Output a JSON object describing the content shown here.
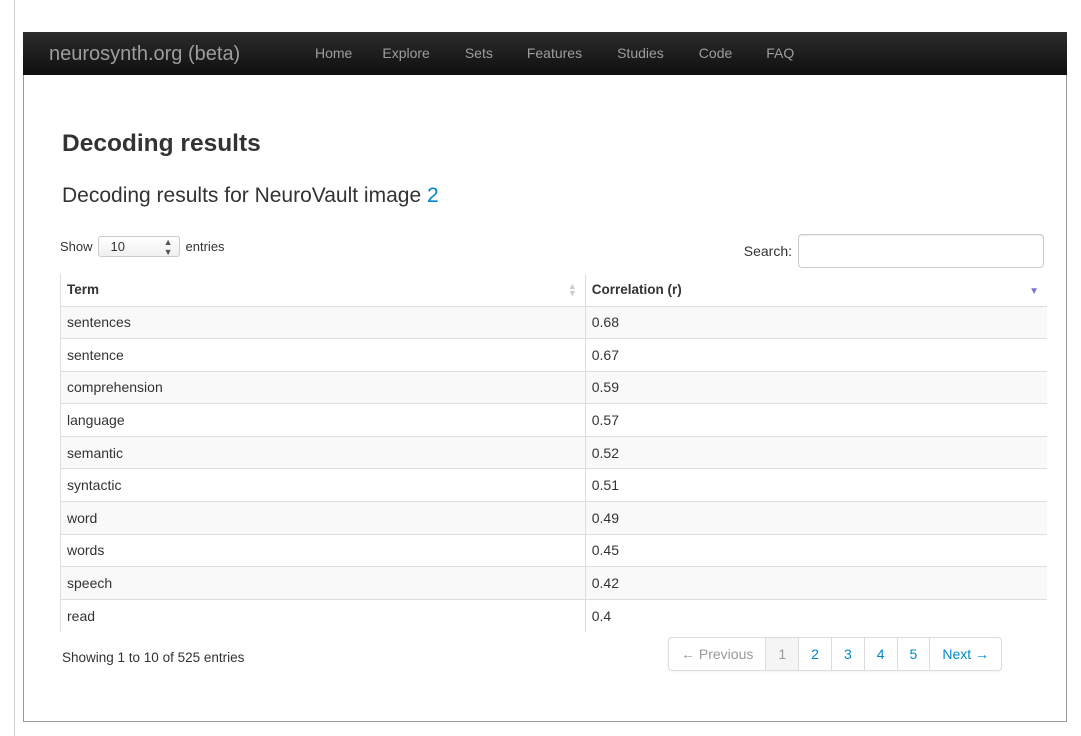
{
  "navbar": {
    "brand": "neurosynth.org (beta)",
    "links": [
      "Home",
      "Explore",
      "Sets",
      "Features",
      "Studies",
      "Code",
      "FAQ"
    ]
  },
  "page": {
    "title": "Decoding results",
    "subtitle_prefix": "Decoding results for NeuroVault image ",
    "subtitle_link": "2"
  },
  "controls": {
    "show_label": "Show",
    "page_length": "10",
    "entries_label": "entries",
    "search_label": "Search:",
    "search_value": ""
  },
  "table": {
    "headers": [
      "Term",
      "Correlation (r)"
    ],
    "rows": [
      [
        "sentences",
        "0.68"
      ],
      [
        "sentence",
        "0.67"
      ],
      [
        "comprehension",
        "0.59"
      ],
      [
        "language",
        "0.57"
      ],
      [
        "semantic",
        "0.52"
      ],
      [
        "syntactic",
        "0.51"
      ],
      [
        "word",
        "0.49"
      ],
      [
        "words",
        "0.45"
      ],
      [
        "speech",
        "0.42"
      ],
      [
        "read",
        "0.4"
      ]
    ]
  },
  "footer": {
    "info": "Showing 1 to 10 of 525 entries",
    "pagination": {
      "previous": "← Previous",
      "pages": [
        "1",
        "2",
        "3",
        "4",
        "5"
      ],
      "current": "1",
      "next": "Next →"
    }
  },
  "colors": {
    "link": "#0088cc",
    "navbar": "#1b1b1b"
  }
}
